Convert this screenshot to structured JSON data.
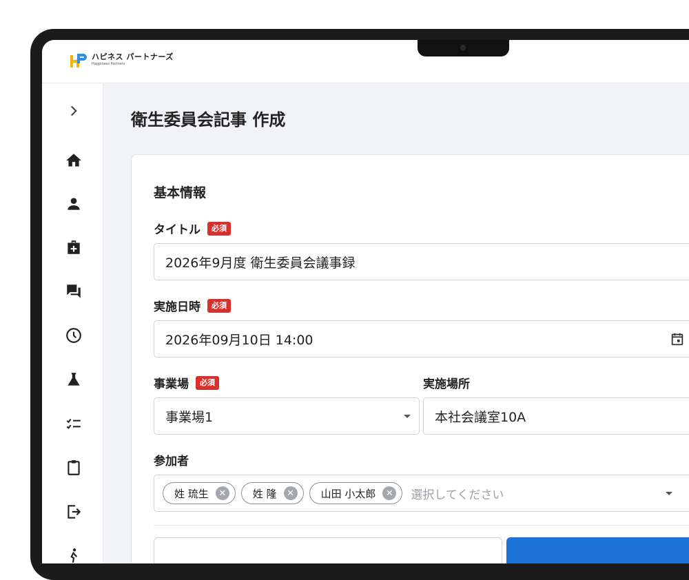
{
  "app": {
    "logo_jp": "ハピネス パートナーズ",
    "logo_en": "Happiness Partners",
    "brand_colors": {
      "h": "#f4b400",
      "p": "#2f8fe0",
      "accent": "#1e73d8",
      "required": "#d9302c"
    }
  },
  "sidebar": {
    "items": [
      {
        "icon": "chevron-right-icon"
      },
      {
        "icon": "home-icon"
      },
      {
        "icon": "person-icon"
      },
      {
        "icon": "medical-bag-icon"
      },
      {
        "icon": "chat-icon"
      },
      {
        "icon": "clock-icon"
      },
      {
        "icon": "flask-icon"
      },
      {
        "icon": "checklist-icon"
      },
      {
        "icon": "clipboard-icon"
      },
      {
        "icon": "exit-icon"
      },
      {
        "icon": "person-walk-icon"
      }
    ]
  },
  "page": {
    "title": "衛生委員会記事 作成"
  },
  "form": {
    "section_title": "基本情報",
    "required_badge": "必須",
    "title_label": "タイトル",
    "title_value": "2026年9月度 衛生委員会議事録",
    "datetime_label": "実施日時",
    "datetime_value": "2026年09月10日 14:00",
    "site_label": "事業場",
    "site_value": "事業場1",
    "place_label": "実施場所",
    "place_value": "本社会議室10A",
    "participants_label": "参加者",
    "participants": [
      "姓 琉生",
      "姓 隆",
      "山田 小太郎"
    ],
    "participants_placeholder": "選択してください"
  }
}
